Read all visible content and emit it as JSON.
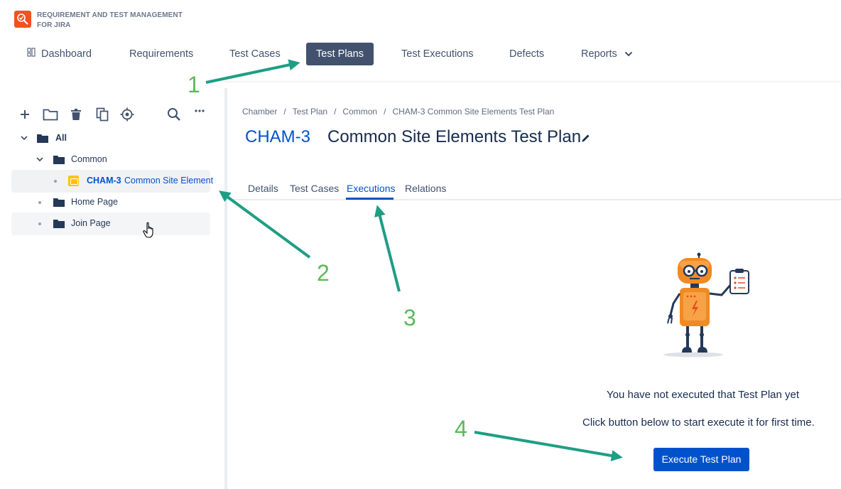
{
  "app": {
    "name_line1": "REQUIREMENT AND TEST MANAGEMENT",
    "name_line2": "FOR JIRA"
  },
  "nav": {
    "items": [
      {
        "label": "Dashboard",
        "icon": "dashboard-icon"
      },
      {
        "label": "Requirements"
      },
      {
        "label": "Test Cases"
      },
      {
        "label": "Test Plans",
        "active": true
      },
      {
        "label": "Test Executions"
      },
      {
        "label": "Defects"
      },
      {
        "label": "Reports",
        "icon": "chevron-down-icon"
      }
    ]
  },
  "sidebar": {
    "toolbar": [
      "add-icon",
      "folder-icon",
      "trash-icon",
      "copy-icon",
      "target-icon",
      "search-icon",
      "more-icon"
    ],
    "tree": {
      "root": "All",
      "common": "Common",
      "plan_key": "CHAM-3",
      "plan_name": "Common Site Element",
      "home": "Home Page",
      "join": "Join Page"
    }
  },
  "breadcrumbs": [
    "Chamber",
    "Test Plan",
    "Common",
    "CHAM-3 Common Site Elements Test Plan"
  ],
  "issue": {
    "key": "CHAM-3",
    "title": "Common Site Elements Test Plan"
  },
  "tabs": [
    "Details",
    "Test Cases",
    "Executions",
    "Relations"
  ],
  "active_tab": "Executions",
  "empty_state": {
    "line1": "You have not executed that Test Plan yet",
    "line2": "Click button below to start execute it for first time.",
    "button": "Execute Test Plan"
  },
  "annotations": {
    "steps": [
      "1",
      "2",
      "3",
      "4"
    ],
    "color": "#5cb85c",
    "arrow_color": "#1e9e84"
  },
  "colors": {
    "brand": "#f4511e",
    "nav_active_bg": "#42526e",
    "link_blue": "#0052cc",
    "folder": "#253858",
    "test_plan_icon": "#ffc400"
  }
}
